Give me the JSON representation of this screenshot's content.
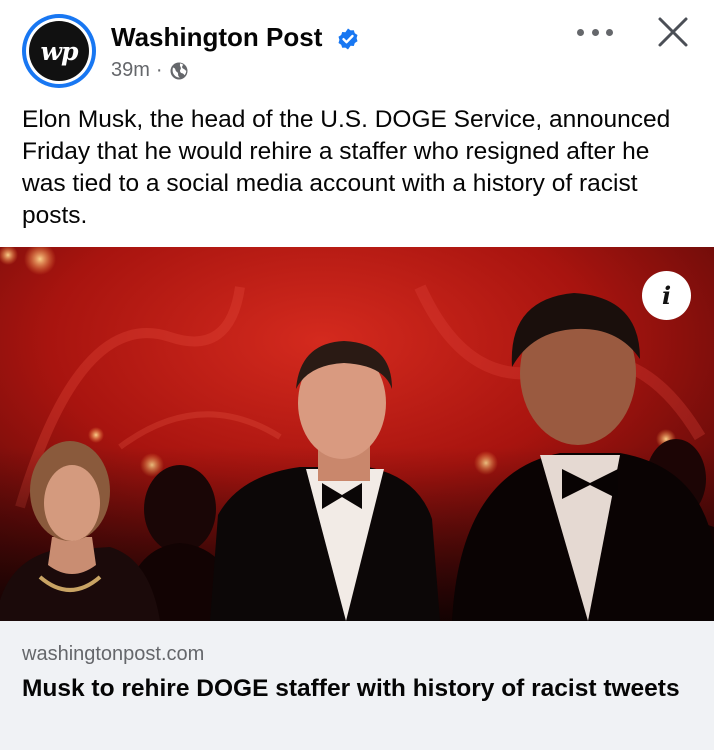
{
  "post": {
    "page_name": "Washington Post",
    "avatar_text": "wp",
    "time": "39m",
    "separator": "·",
    "audience_icon": "globe-icon",
    "verified_icon": "verified-badge-icon",
    "text": "Elon Musk, the head of the U.S. DOGE Service, announced Friday that he would rehire a staffer who resigned after he was tied to a social media account with a history of racist posts."
  },
  "actions": {
    "more_icon": "more-options-icon",
    "close_icon": "close-icon"
  },
  "photo": {
    "info_label": "i"
  },
  "link": {
    "domain": "washingtonpost.com",
    "title": "Musk to rehire DOGE staffer with history of racist tweets"
  },
  "colors": {
    "accent": "#1877f2",
    "secondary_text": "#65676b",
    "card_background": "#f0f2f5",
    "photo_red": "#b51a14"
  }
}
